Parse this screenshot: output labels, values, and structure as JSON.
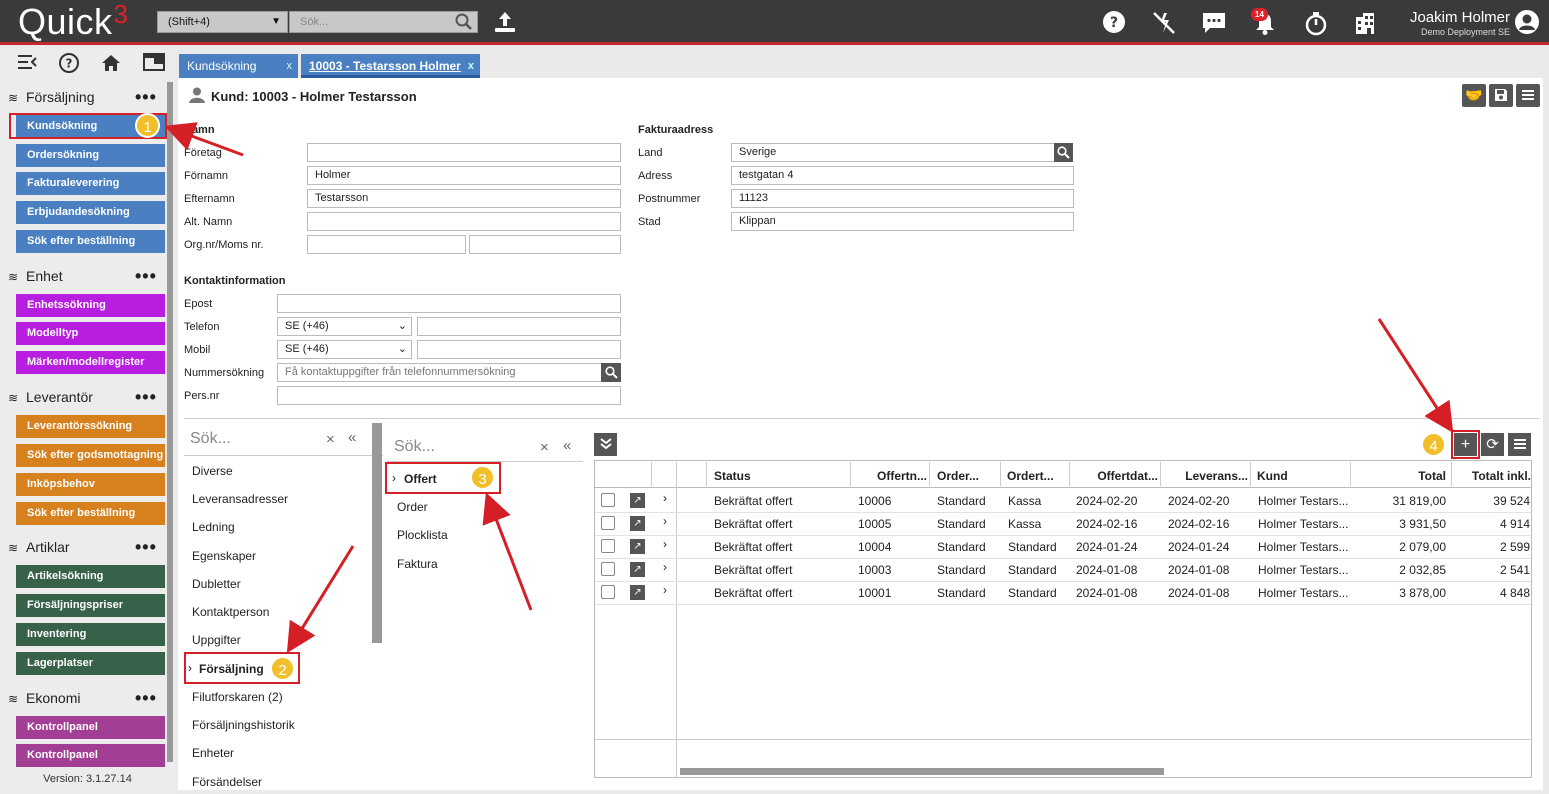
{
  "app": {
    "logo_text": "Quick",
    "logo_sup": "3",
    "shortcut": "(Shift+4)",
    "search_placeholder": "Sök...",
    "notification_count": "14",
    "user_name": "Joakim Holmer",
    "user_org": "Demo Deployment SE"
  },
  "sidebar": {
    "sections": [
      {
        "title": "Försäljning",
        "items": [
          "Kundsökning",
          "Ordersökning",
          "Fakturaleverering",
          "Erbjudandesökning",
          "Sök efter beställning"
        ]
      },
      {
        "title": "Enhet",
        "items": [
          "Enhetssökning",
          "Modelltyp",
          "Märken/modellregister"
        ]
      },
      {
        "title": "Leverantör",
        "items": [
          "Leverantörssökning",
          "Sök efter godsmottagning",
          "Inköpsbehov",
          "Sök efter beställning"
        ]
      },
      {
        "title": "Artiklar",
        "items": [
          "Artikelsökning",
          "Försäljningspriser",
          "Inventering",
          "Lagerplatser"
        ]
      },
      {
        "title": "Ekonomi",
        "items": [
          "Kontrollpanel",
          "Kontrollpanel"
        ]
      }
    ],
    "dots": "•••",
    "version": "Version: 3.1.27.14"
  },
  "tabs": [
    {
      "label": "Kundsökning",
      "close": "x"
    },
    {
      "label": "10003 - Testarsson Holmer",
      "close": "x"
    }
  ],
  "customer": {
    "title": "Kund: 10003 - Holmer Testarsson",
    "name_section": "Namn",
    "labels": {
      "company": "Företag",
      "first": "Förnamn",
      "last": "Efternamn",
      "alt": "Alt. Namn",
      "org": "Org.nr/Moms nr."
    },
    "values": {
      "company": "",
      "first": "Holmer",
      "last": "Testarsson",
      "alt": "",
      "org1": "",
      "org2": ""
    },
    "invoice_section": "Fakturaadress",
    "inv_labels": {
      "country": "Land",
      "address": "Adress",
      "zip": "Postnummer",
      "city": "Stad"
    },
    "inv_values": {
      "country": "Sverige",
      "address": "testgatan 4",
      "zip": "11123",
      "city": "Klippan"
    },
    "contact_section": "Kontaktinformation",
    "contact_labels": {
      "email": "Epost",
      "phone": "Telefon",
      "mobile": "Mobil",
      "lookup": "Nummersökning",
      "pers": "Pers.nr"
    },
    "contact_values": {
      "email": "",
      "phone_cc": "SE (+46)",
      "phone": "",
      "mobile_cc": "SE (+46)",
      "mobile": "",
      "pers": ""
    },
    "lookup_placeholder": "Få kontaktuppgifter från telefonnummersökning"
  },
  "panel1": {
    "search_placeholder": "Sök...",
    "items": [
      "Diverse",
      "Leveransadresser",
      "Ledning",
      "Egenskaper",
      "Dubletter",
      "Kontaktperson",
      "Uppgifter",
      "Försäljning",
      "Filutforskaren (2)",
      "Försäljningshistorik",
      "Enheter",
      "Försändelser"
    ]
  },
  "panel2": {
    "search_placeholder": "Sök...",
    "items": [
      "Offert",
      "Order",
      "Plocklista",
      "Faktura"
    ]
  },
  "grid": {
    "columns": [
      "Status",
      "Offertn...",
      "Order...",
      "Ordert...",
      "Offertdat...",
      "Leverans...",
      "Kund",
      "Total",
      "Totalt inkl."
    ],
    "rows": [
      [
        "Bekräftat offert",
        "10006",
        "Standard",
        "Kassa",
        "2024-02-20",
        "2024-02-20",
        "Holmer Testars...",
        "31 819,00",
        "39 524"
      ],
      [
        "Bekräftat offert",
        "10005",
        "Standard",
        "Kassa",
        "2024-02-16",
        "2024-02-16",
        "Holmer Testars...",
        "3 931,50",
        "4 914"
      ],
      [
        "Bekräftat offert",
        "10004",
        "Standard",
        "Standard",
        "2024-01-24",
        "2024-01-24",
        "Holmer Testars...",
        "2 079,00",
        "2 599"
      ],
      [
        "Bekräftat offert",
        "10003",
        "Standard",
        "Standard",
        "2024-01-08",
        "2024-01-08",
        "Holmer Testars...",
        "2 032,85",
        "2 541"
      ],
      [
        "Bekräftat offert",
        "10001",
        "Standard",
        "Standard",
        "2024-01-08",
        "2024-01-08",
        "Holmer Testars...",
        "3 878,00",
        "4 848"
      ]
    ]
  },
  "callouts": [
    "1",
    "2",
    "3",
    "4"
  ]
}
